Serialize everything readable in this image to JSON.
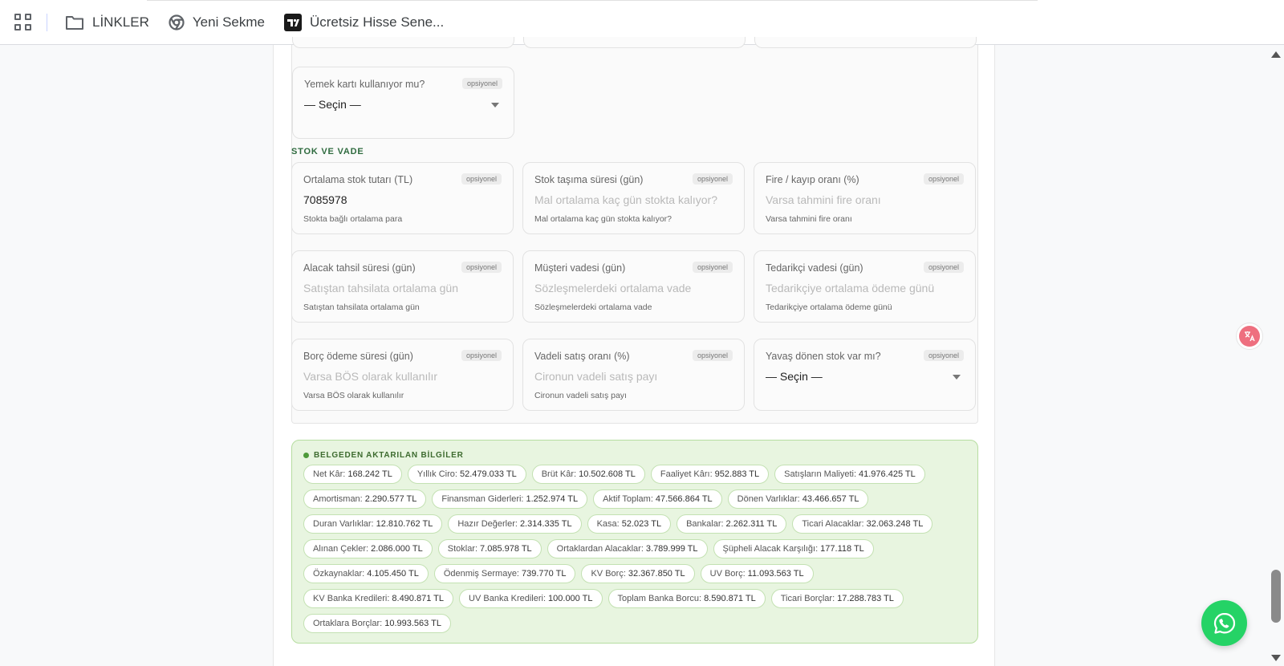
{
  "bookmarks": {
    "items": [
      {
        "label": "LİNKLER",
        "icon": "folder-icon"
      },
      {
        "label": "Yeni Sekme",
        "icon": "chrome-icon"
      },
      {
        "label": "Ücretsiz Hisse Sene...",
        "icon": "tradingview-icon"
      }
    ]
  },
  "form": {
    "optional_badge": "opsiyonel",
    "yemek": {
      "label": "Yemek kartı kullanıyor mu?",
      "value": "— Seçin —"
    },
    "section_title": "STOK VE VADE",
    "fields": [
      {
        "label": "Ortalama stok tutarı (TL)",
        "value": "7085978",
        "placeholder": "",
        "hint": "Stokta bağlı ortalama para"
      },
      {
        "label": "Stok taşıma süresi (gün)",
        "value": "",
        "placeholder": "Mal ortalama kaç gün stokta kalıyor?",
        "hint": "Mal ortalama kaç gün stokta kalıyor?"
      },
      {
        "label": "Fire / kayıp oranı (%)",
        "value": "",
        "placeholder": "Varsa tahmini fire oranı",
        "hint": "Varsa tahmini fire oranı"
      },
      {
        "label": "Alacak tahsil süresi (gün)",
        "value": "",
        "placeholder": "Satıştan tahsilata ortalama gün",
        "hint": "Satıştan tahsilata ortalama gün"
      },
      {
        "label": "Müşteri vadesi (gün)",
        "value": "",
        "placeholder": "Sözleşmelerdeki ortalama vade",
        "hint": "Sözleşmelerdeki ortalama vade"
      },
      {
        "label": "Tedarikçi vadesi (gün)",
        "value": "",
        "placeholder": "Tedarikçiye ortalama ödeme günü",
        "hint": "Tedarikçiye ortalama ödeme günü"
      },
      {
        "label": "Borç ödeme süresi (gün)",
        "value": "",
        "placeholder": "Varsa BÖS olarak kullanılır",
        "hint": "Varsa BÖS olarak kullanılır"
      },
      {
        "label": "Vadeli satış oranı (%)",
        "value": "",
        "placeholder": "Cironun vadeli satış payı",
        "hint": "Cironun vadeli satış payı"
      }
    ],
    "yavas": {
      "label": "Yavaş dönen stok var mı?",
      "value": "— Seçin —"
    }
  },
  "extracted": {
    "title": "BELGEDEN AKTARILAN BİLGİLER",
    "chips": [
      {
        "key": "Net Kâr:",
        "value": "168.242 TL"
      },
      {
        "key": "Yıllık Ciro:",
        "value": "52.479.033 TL"
      },
      {
        "key": "Brüt Kâr:",
        "value": "10.502.608 TL"
      },
      {
        "key": "Faaliyet Kârı:",
        "value": "952.883 TL"
      },
      {
        "key": "Satışların Maliyeti:",
        "value": "41.976.425 TL"
      },
      {
        "key": "Amortisman:",
        "value": "2.290.577 TL"
      },
      {
        "key": "Finansman Giderleri:",
        "value": "1.252.974 TL"
      },
      {
        "key": "Aktif Toplam:",
        "value": "47.566.864 TL"
      },
      {
        "key": "Dönen Varlıklar:",
        "value": "43.466.657 TL"
      },
      {
        "key": "Duran Varlıklar:",
        "value": "12.810.762 TL"
      },
      {
        "key": "Hazır Değerler:",
        "value": "2.314.335 TL"
      },
      {
        "key": "Kasa:",
        "value": "52.023 TL"
      },
      {
        "key": "Bankalar:",
        "value": "2.262.311 TL"
      },
      {
        "key": "Ticari Alacaklar:",
        "value": "32.063.248 TL"
      },
      {
        "key": "Alınan Çekler:",
        "value": "2.086.000 TL"
      },
      {
        "key": "Stoklar:",
        "value": "7.085.978 TL"
      },
      {
        "key": "Ortaklardan Alacaklar:",
        "value": "3.789.999 TL"
      },
      {
        "key": "Şüpheli Alacak Karşılığı:",
        "value": "177.118 TL"
      },
      {
        "key": "Özkaynaklar:",
        "value": "4.105.450 TL"
      },
      {
        "key": "Ödenmiş Sermaye:",
        "value": "739.770 TL"
      },
      {
        "key": "KV Borç:",
        "value": "32.367.850 TL"
      },
      {
        "key": "UV Borç:",
        "value": "11.093.563 TL"
      },
      {
        "key": "KV Banka Kredileri:",
        "value": "8.490.871 TL"
      },
      {
        "key": "UV Banka Kredileri:",
        "value": "100.000 TL"
      },
      {
        "key": "Toplam Banka Borcu:",
        "value": "8.590.871 TL"
      },
      {
        "key": "Ticari Borçlar:",
        "value": "17.288.783 TL"
      },
      {
        "key": "Ortaklara Borçlar:",
        "value": "10.993.563 TL"
      }
    ]
  },
  "colors": {
    "accent_green": "#25d366",
    "section_green": "#2f6b3f",
    "info_bg": "#e8f5e0"
  }
}
